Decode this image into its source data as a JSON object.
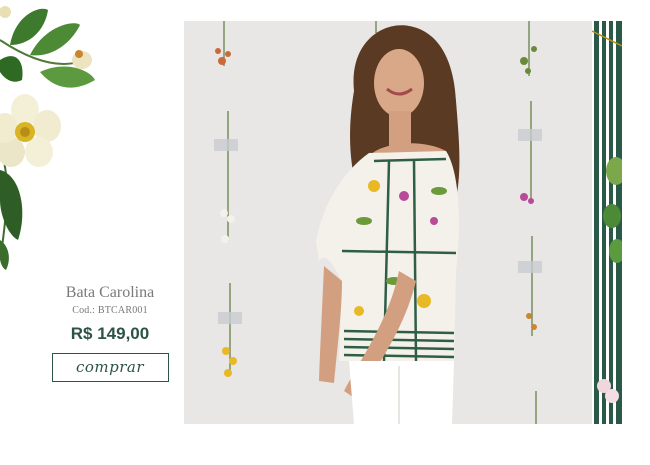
{
  "product": {
    "name": "Bata Carolina",
    "code": "Cod.: BTCAR001",
    "price": "R$ 149,00",
    "buy_label": "comprar"
  },
  "colors": {
    "brand_green": "#2b5446",
    "stripe_green": "#2a5a47",
    "photo_background": "#e9e7e5"
  },
  "icons": {
    "flower": "decorative-flower-icon"
  }
}
